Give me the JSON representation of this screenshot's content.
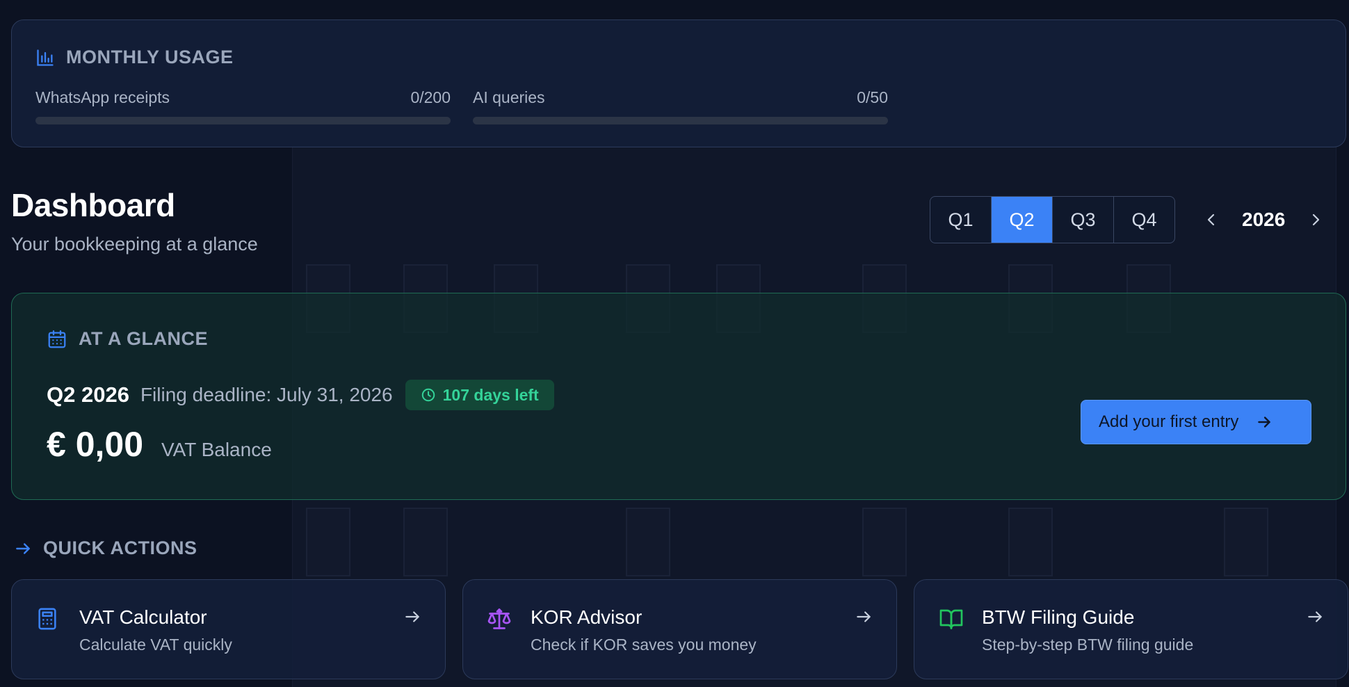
{
  "usage": {
    "heading": "MONTHLY USAGE",
    "items": [
      {
        "label": "WhatsApp receipts",
        "count": "0/200",
        "fraction": 0
      },
      {
        "label": "AI queries",
        "count": "0/50",
        "fraction": 0
      }
    ]
  },
  "header": {
    "title": "Dashboard",
    "subtitle": "Your bookkeeping at a glance",
    "quarters": [
      "Q1",
      "Q2",
      "Q3",
      "Q4"
    ],
    "active_quarter": "Q2",
    "year": "2026"
  },
  "glance": {
    "heading": "AT A GLANCE",
    "period": "Q2 2026",
    "deadline": "Filing deadline: July 31, 2026",
    "days_left": "107 days left",
    "amount": "€ 0,00",
    "amount_label": "VAT Balance",
    "cta": "Add your first entry"
  },
  "quick_actions": {
    "heading": "QUICK ACTIONS",
    "items": [
      {
        "title": "VAT Calculator",
        "desc": "Calculate VAT quickly",
        "icon": "calculator-icon",
        "color": "#3b82f6"
      },
      {
        "title": "KOR Advisor",
        "desc": "Check if KOR saves you money",
        "icon": "scale-icon",
        "color": "#a855f7"
      },
      {
        "title": "BTW Filing Guide",
        "desc": "Step-by-step BTW filing guide",
        "icon": "book-open-icon",
        "color": "#22c55e"
      }
    ]
  },
  "colors": {
    "accent": "#3b82f6",
    "success": "#34d399",
    "background": "#0c1222"
  }
}
